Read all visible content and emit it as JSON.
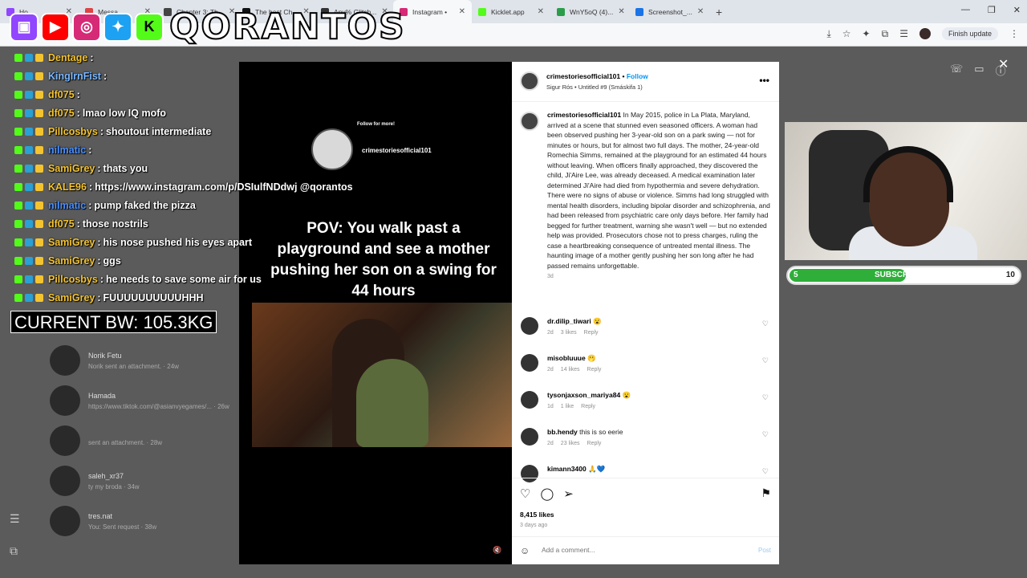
{
  "browser": {
    "tabs": [
      {
        "label": "Ho...",
        "color": "#9146ff"
      },
      {
        "label": "Messa...",
        "color": "#d44"
      },
      {
        "label": "Chapter 3: Th...",
        "color": "#444"
      },
      {
        "label": "The best Ch...",
        "color": "#111"
      },
      {
        "label": "Any% Glitch...",
        "color": "#333"
      },
      {
        "label": "Instagram •",
        "color": "#d62976"
      },
      {
        "label": "Kicklet.app",
        "color": "#53fc18"
      },
      {
        "label": "WnY5oQ (4)...",
        "color": "#2a9d4a"
      },
      {
        "label": "Screenshot_...",
        "color": "#1a73e8"
      }
    ],
    "new_tab": "+",
    "finish_update": "Finish update"
  },
  "overlay": {
    "brand": "QORANTOS",
    "bw_label": "CURRENT BW: 105.3KG",
    "chat": [
      {
        "user": "Dentage",
        "color": "#f4c430",
        "msg": ""
      },
      {
        "user": "KingIrnFist",
        "color": "#7ab8ff",
        "msg": ""
      },
      {
        "user": "df075",
        "color": "#f4c430",
        "msg": ""
      },
      {
        "user": "df075",
        "color": "#f4c430",
        "msg": "lmao low IQ mofo"
      },
      {
        "user": "Pillcosbys",
        "color": "#f4c430",
        "msg": "shoutout intermediate"
      },
      {
        "user": "nilmatic",
        "color": "#4a90ff",
        "msg": ""
      },
      {
        "user": "SamiGrey",
        "color": "#f4c430",
        "msg": "thats you"
      },
      {
        "user": "KALE96",
        "color": "#f4c430",
        "msg": "https://www.instagram.com/p/DSIulfNDdwj @qorantos"
      },
      {
        "user": "nilmatic",
        "color": "#4a90ff",
        "msg": "pump faked the pizza"
      },
      {
        "user": "df075",
        "color": "#f4c430",
        "msg": "those nostrils"
      },
      {
        "user": "SamiGrey",
        "color": "#f4c430",
        "msg": "his nose pushed his eyes apart"
      },
      {
        "user": "SamiGrey",
        "color": "#f4c430",
        "msg": "ggs"
      },
      {
        "user": "Pillcosbys",
        "color": "#f4c430",
        "msg": "he needs to save some air for us"
      },
      {
        "user": "SamiGrey",
        "color": "#f4c430",
        "msg": "FUUUUUUUUUUHHH"
      }
    ],
    "subscribers": {
      "current": "5",
      "label": "SUBSCRIBERS",
      "goal": "10",
      "progress": 0.5
    }
  },
  "dm_list": [
    {
      "name": "Norik Fetu",
      "sub": "Norik sent an attachment. · 24w"
    },
    {
      "name": "Hamada",
      "sub": "https://www.tiktok.com/@asianvyegames/... · 26w"
    },
    {
      "name": "",
      "sub": "sent an attachment. · 28w"
    },
    {
      "name": "saleh_xr37",
      "sub": "ty my broda · 34w"
    },
    {
      "name": "tres.nat",
      "sub": "You: Sent request · 38w"
    }
  ],
  "reel": {
    "follow_more": "Follow for more!",
    "handle": "crimestoriesofficial101",
    "pov_text": "POV: You walk past a playground and see a mother pushing her son on a swing for 44 hours"
  },
  "post": {
    "username": "crimestoriesofficial101",
    "follow": "Follow",
    "audio": "Sigur Rós • Untitled #9 (Smáskifa 1)",
    "caption": "In May 2015, police in La Plata, Maryland, arrived at a scene that stunned even seasoned officers. A woman had been observed pushing her 3-year-old son on a park swing — not for minutes or hours, but for almost two full days. The mother, 24-year-old Romechia Simms, remained at the playground for an estimated 44 hours without leaving. When officers finally approached, they discovered the child, Ji'Aire Lee, was already deceased. A medical examination later determined Ji'Aire had died from hypothermia and severe dehydration. There were no signs of abuse or violence. Simms had long struggled with mental health disorders, including bipolar disorder and schizophrenia, and had been released from psychiatric care only days before. Her family had begged for further treatment, warning she wasn't well — but no extended help was provided. Prosecutors chose not to press charges, ruling the case a heartbreaking consequence of untreated mental illness. The haunting image of a mother gently pushing her son long after he had passed remains unforgettable.",
    "caption_time": "3d",
    "comments": [
      {
        "user": "dr.dilip_tiwari",
        "text": "😮",
        "time": "2d",
        "likes": "3 likes",
        "reply": "Reply"
      },
      {
        "user": "misobluuue",
        "text": "🫢",
        "time": "2d",
        "likes": "14 likes",
        "reply": "Reply"
      },
      {
        "user": "tysonjaxson_mariya84",
        "text": "😮",
        "time": "1d",
        "likes": "1 like",
        "reply": "Reply"
      },
      {
        "user": "bb.hendy",
        "text": "this is so eerie",
        "time": "2d",
        "likes": "23 likes",
        "reply": "Reply"
      },
      {
        "user": "kimann3400",
        "text": "🙏💙",
        "time": "",
        "likes": "",
        "reply": ""
      }
    ],
    "likes": "8,415 likes",
    "ago": "3 days ago",
    "comment_placeholder": "Add a comment...",
    "post_label": "Post"
  }
}
